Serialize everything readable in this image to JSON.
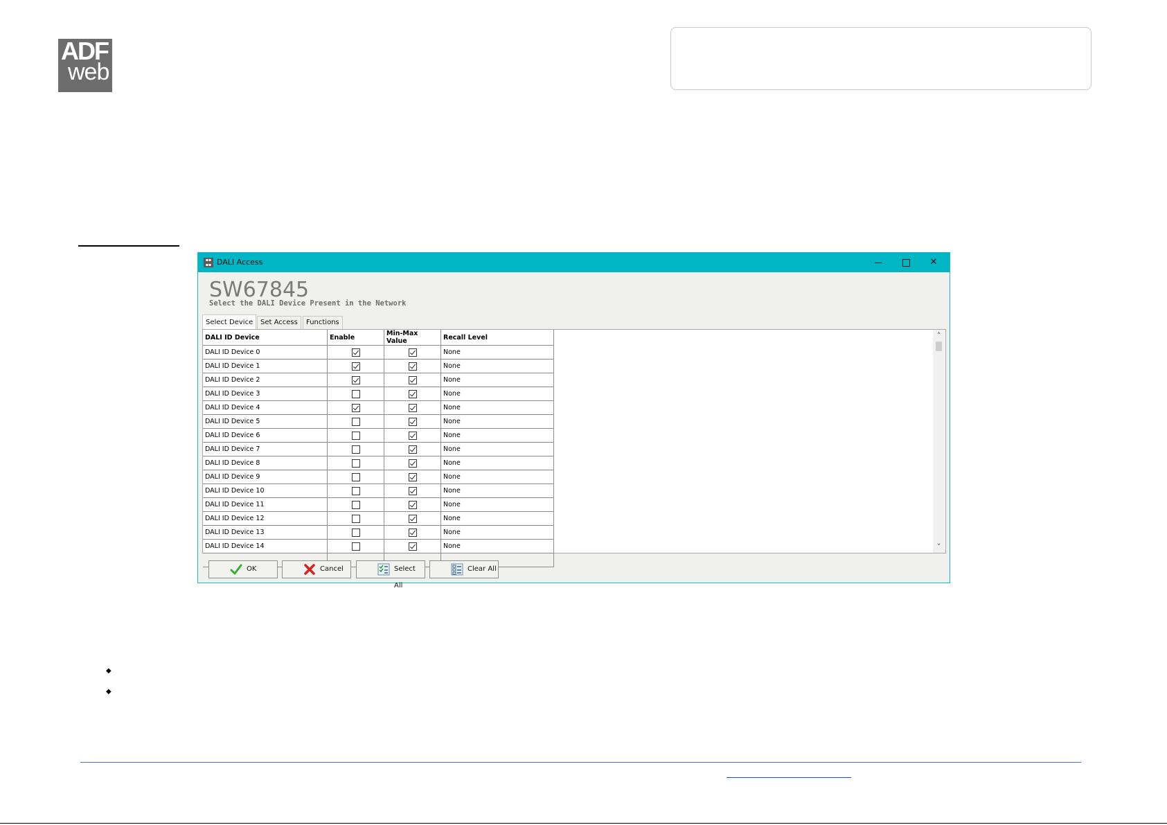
{
  "logo": {
    "line1": "ADF",
    "line2": "web"
  },
  "window": {
    "title": "DALI Access",
    "heading": "SW67845",
    "subheading": "Select the DALI Device Present in the  Network",
    "tabs": [
      {
        "label": "Select Device",
        "active": true
      },
      {
        "label": "Set Access",
        "active": false
      },
      {
        "label": "Functions",
        "active": false
      }
    ],
    "table": {
      "columns": [
        "DALI ID Device",
        "Enable",
        "Min-Max Value",
        "Recall Level"
      ],
      "rows": [
        {
          "device": "DALI ID Device 0",
          "enable": true,
          "minmax": true,
          "recall": "None"
        },
        {
          "device": "DALI ID Device 1",
          "enable": true,
          "minmax": true,
          "recall": "None"
        },
        {
          "device": "DALI ID Device 2",
          "enable": true,
          "minmax": true,
          "recall": "None"
        },
        {
          "device": "DALI ID Device 3",
          "enable": false,
          "minmax": true,
          "recall": "None"
        },
        {
          "device": "DALI ID Device 4",
          "enable": true,
          "minmax": true,
          "recall": "None"
        },
        {
          "device": "DALI ID Device 5",
          "enable": false,
          "minmax": true,
          "recall": "None"
        },
        {
          "device": "DALI ID Device 6",
          "enable": false,
          "minmax": true,
          "recall": "None"
        },
        {
          "device": "DALI ID Device 7",
          "enable": false,
          "minmax": true,
          "recall": "None"
        },
        {
          "device": "DALI ID Device 8",
          "enable": false,
          "minmax": true,
          "recall": "None"
        },
        {
          "device": "DALI ID Device 9",
          "enable": false,
          "minmax": true,
          "recall": "None"
        },
        {
          "device": "DALI ID Device 10",
          "enable": false,
          "minmax": true,
          "recall": "None"
        },
        {
          "device": "DALI ID Device 11",
          "enable": false,
          "minmax": true,
          "recall": "None"
        },
        {
          "device": "DALI ID Device 12",
          "enable": false,
          "minmax": true,
          "recall": "None"
        },
        {
          "device": "DALI ID Device 13",
          "enable": false,
          "minmax": true,
          "recall": "None"
        },
        {
          "device": "DALI ID Device 14",
          "enable": false,
          "minmax": true,
          "recall": "None"
        }
      ]
    },
    "buttons": {
      "ok": "OK",
      "cancel": "Cancel",
      "select_all": "Select All",
      "clear_all": "Clear All"
    }
  },
  "colors": {
    "titlebar": "#00b6c4",
    "ok_check": "#3cad3c",
    "cancel_x": "#d92020",
    "footer_rule": "#4a6fb5"
  }
}
